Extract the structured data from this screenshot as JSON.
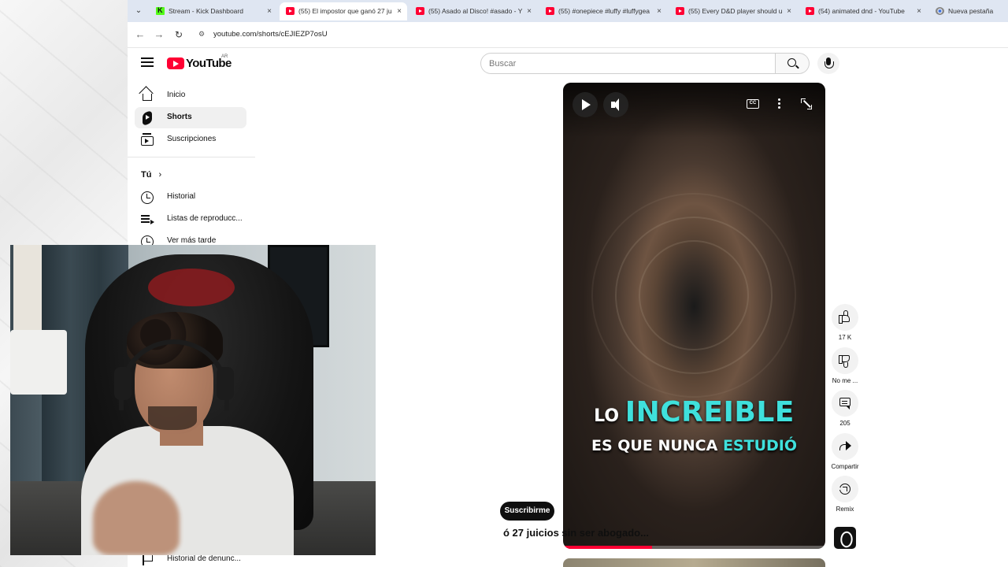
{
  "tabs": [
    {
      "favicon": "kick-icon",
      "label": "Stream - Kick Dashboard",
      "active": false
    },
    {
      "favicon": "youtube-icon",
      "label": "(55) El impostor que ganó 27 ju",
      "active": true
    },
    {
      "favicon": "youtube-icon",
      "label": "(55) Asado al Disco! #asado - Y",
      "active": false
    },
    {
      "favicon": "youtube-icon",
      "label": "(55) #onepiece #luffy #luffygea",
      "active": false
    },
    {
      "favicon": "youtube-icon",
      "label": "(55) Every D&D player should u",
      "active": false
    },
    {
      "favicon": "youtube-icon",
      "label": "(54) animated dnd - YouTube",
      "active": false
    },
    {
      "favicon": "chrome-icon",
      "label": "Nueva pestaña",
      "active": false
    }
  ],
  "tab_close_glyph": "×",
  "address_bar": {
    "url": "youtube.com/shorts/cEJIEZP7osU"
  },
  "youtube": {
    "logo_text": "YouTube",
    "country_code": "AR",
    "search_placeholder": "Buscar"
  },
  "sidebar": {
    "items": [
      {
        "label": "Inicio",
        "icon": "home-icon",
        "active": false
      },
      {
        "label": "Shorts",
        "icon": "shorts-icon",
        "active": true
      },
      {
        "label": "Suscripciones",
        "icon": "subscriptions-icon",
        "active": false
      }
    ],
    "you_heading": "Tú",
    "you_chevron": "›",
    "you_items": [
      {
        "label": "Historial",
        "icon": "history-icon"
      },
      {
        "label": "Listas de reproducc...",
        "icon": "playlists-icon"
      },
      {
        "label": "Ver más tarde",
        "icon": "watch-later-icon"
      }
    ],
    "bottom_item": {
      "label": "Historial de denunc...",
      "icon": "flag-icon"
    }
  },
  "video": {
    "caption_line1_prefix": "LO ",
    "caption_line1_highlight": "INCREIBLE",
    "caption_line2_prefix": "ES QUE NUNCA ",
    "caption_line2_highlight": "ESTUDIÓ",
    "cc_label": "CC",
    "progress_fraction": 0.34,
    "accent_color": "#3fe0dc"
  },
  "actions": {
    "like_count": "17 K",
    "dislike_label": "No me ...",
    "comment_count": "205",
    "share_label": "Compartir",
    "remix_label": "Remix"
  },
  "channel": {
    "subscribe_label": "Suscribirme",
    "video_title": "ó 27 juicios sin ser abogado..."
  }
}
